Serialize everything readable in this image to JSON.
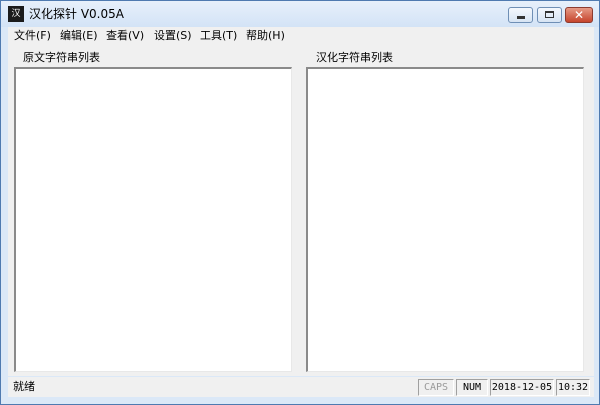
{
  "window": {
    "title": "汉化探针  V0.05A",
    "app_icon_glyph": "汉",
    "min_icon": "minimize-icon",
    "max_icon": "maximize-icon",
    "close_icon": "close-icon",
    "close_glyph": "✕"
  },
  "menu": {
    "items": [
      "文件(F)",
      "编辑(E)",
      "查看(V)",
      "设置(S)",
      "工具(T)",
      "帮助(H)"
    ]
  },
  "panels": {
    "left_label": "原文字符串列表",
    "right_label": "汉化字符串列表"
  },
  "status": {
    "text": "就绪",
    "caps": "CAPS",
    "num": "NUM",
    "date": "2018-12-05",
    "time": "10:32"
  },
  "colors": {
    "titlebar": "#d3e3f6",
    "close_button": "#c6452d",
    "caps_inactive": "#9a9a9a"
  }
}
